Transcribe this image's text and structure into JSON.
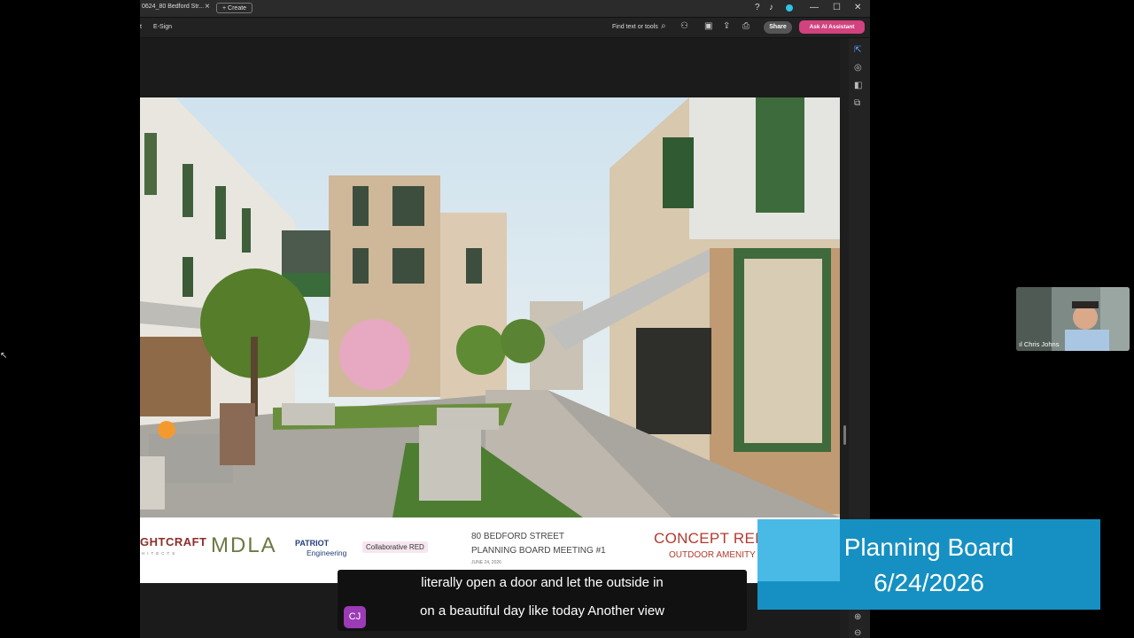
{
  "tabbar": {
    "doc_tab_title": "0624_80 Bedford Str...",
    "close_glyph": "×",
    "create_label": "Create"
  },
  "toolbar": {
    "left_item": "t",
    "esign_label": "E-Sign",
    "find_label": "Find text or tools",
    "share_label": "Share",
    "ai_label": "Ask AI Assistant"
  },
  "slide": {
    "logos": {
      "brightcraft": "GHTCRAFT",
      "brightcraft_sub": "HITECTS",
      "mdla": "MDLA",
      "patriot": "PATRIOT",
      "patriot_sub": "Engineering",
      "collab": "Collaborative RED"
    },
    "project_line1": "80 BEDFORD STREET",
    "project_line2": "PLANNING BOARD MEETING #1",
    "project_date": "JUNE 24, 2026",
    "concept_title": "CONCEPT RENDERING",
    "concept_sub": "OUTDOOR AMENITY FACING EAST"
  },
  "subtitles": {
    "line1": "literally open a door and let the outside in",
    "line2": "on a beautiful day like today Another view",
    "speaker_initials": "CJ"
  },
  "banner": {
    "title": "Planning Board",
    "date": "6/24/2026"
  },
  "participant": {
    "name": "Chris Johns"
  },
  "colors": {
    "ai_button": "#d1427e",
    "banner": "#1690c2",
    "concept_red": "#b33a2e"
  }
}
